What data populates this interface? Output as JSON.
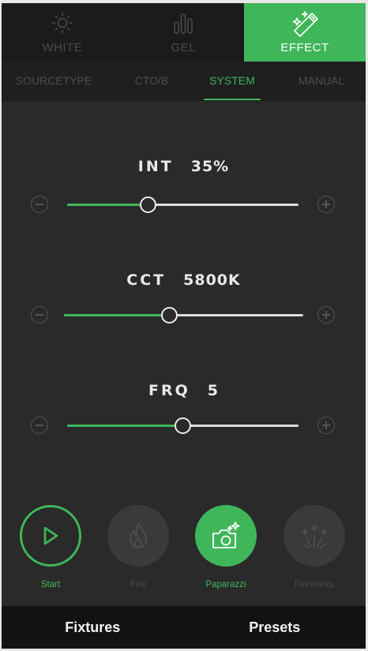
{
  "mode_tabs": [
    {
      "label": "WHITE",
      "icon": "sun-icon",
      "active": false
    },
    {
      "label": "GEL",
      "icon": "bars-icon",
      "active": false
    },
    {
      "label": "EFFECT",
      "icon": "magic-wand-icon",
      "active": true
    }
  ],
  "sub_tabs": [
    {
      "label": "SOURCETYPE",
      "active": false
    },
    {
      "label": "CTO/B",
      "active": false
    },
    {
      "label": "SYSTEM",
      "active": true
    },
    {
      "label": "MANUAL",
      "active": false
    }
  ],
  "params": [
    {
      "name": "INT",
      "value": "35%",
      "level": 0.35
    },
    {
      "name": "CCT",
      "value": "5800K",
      "level": 0.44
    },
    {
      "name": "FRQ",
      "value": "5",
      "level": 0.5
    }
  ],
  "effects": [
    {
      "label": "Start",
      "icon": "play-icon",
      "state": "start"
    },
    {
      "label": "Fire",
      "icon": "flame-icon",
      "state": "off"
    },
    {
      "label": "Paparazzi",
      "icon": "camera-sparkle-icon",
      "state": "on"
    },
    {
      "label": "Fireworks",
      "icon": "fireworks-icon",
      "state": "off"
    }
  ],
  "bottom_tabs": [
    "Fixtures",
    "Presets"
  ],
  "colors": {
    "accent": "#3fb65a",
    "background": "#2a2a2a",
    "track": "#dcdcdc"
  }
}
